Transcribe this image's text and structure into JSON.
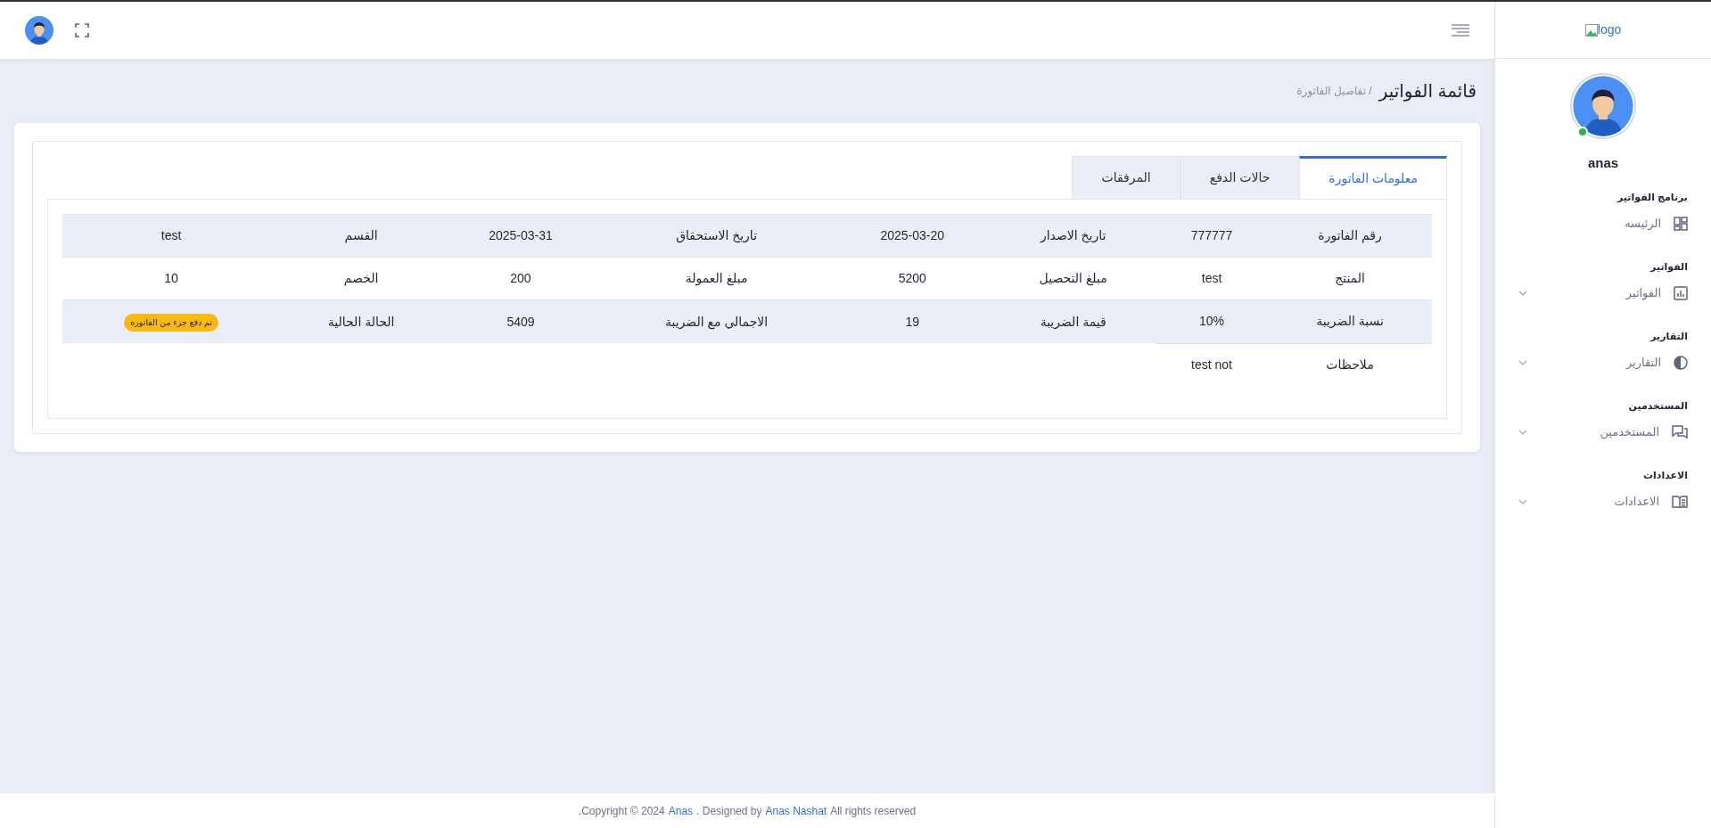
{
  "sidebar": {
    "logo": "logo",
    "user": "anas",
    "sections": [
      {
        "heading": "برنامج الفواتير",
        "item": {
          "label": "الرئيسه",
          "submenu": false
        }
      },
      {
        "heading": "الفواتير",
        "item": {
          "label": "الفواتير",
          "submenu": true
        }
      },
      {
        "heading": "التقارير",
        "item": {
          "label": "التقارير",
          "submenu": true
        }
      },
      {
        "heading": "المستخدمين",
        "item": {
          "label": "المستخدمين",
          "submenu": true
        }
      },
      {
        "heading": "الاعدادات",
        "item": {
          "label": "الاعدادات",
          "submenu": true
        }
      }
    ]
  },
  "page": {
    "title": "قائمة الفواتير",
    "breadcrumb": "/ تفاصيل الفاتورة"
  },
  "tabs": [
    {
      "label": "معلومات الفاتورة",
      "selected": true
    },
    {
      "label": "حالات الدفع",
      "selected": false
    },
    {
      "label": "المرفقات",
      "selected": false
    }
  ],
  "table": {
    "rows": [
      {
        "pairs": [
          {
            "label": "رقم الفاتورة",
            "value": "777777",
            "kind": "text"
          },
          {
            "label": "تاريخ الاصدار",
            "value": "2025-03-20",
            "kind": "text"
          },
          {
            "label": "تاريخ الاستحقاق",
            "value": "2025-03-31",
            "kind": "text"
          },
          {
            "label": "القسم",
            "value": "test",
            "kind": "text"
          }
        ]
      },
      {
        "pairs": [
          {
            "label": "المنتج",
            "value": "test",
            "kind": "text"
          },
          {
            "label": "مبلغ التحصيل",
            "value": "5200",
            "kind": "text"
          },
          {
            "label": "مبلغ العمولة",
            "value": "200",
            "kind": "text"
          },
          {
            "label": "الخصم",
            "value": "10",
            "kind": "text"
          }
        ]
      },
      {
        "pairs": [
          {
            "label": "نسبة الضريبة",
            "value": "10%",
            "kind": "text"
          },
          {
            "label": "قيمة الضريبة",
            "value": "19",
            "kind": "text"
          },
          {
            "label": "الاجمالي مع الضريبة",
            "value": "5409",
            "kind": "text"
          },
          {
            "label": "الحالة الحالية",
            "value": "تم دفع جزء من الفاتوره",
            "kind": "badge"
          }
        ]
      },
      {
        "pairs": [
          {
            "label": "ملاحظات",
            "value": "test not",
            "kind": "text"
          }
        ]
      }
    ]
  },
  "footer": {
    "parts": [
      {
        "kind": "text",
        "text": "All rights reserved"
      },
      {
        "kind": "link",
        "text": "Anas Nashat"
      },
      {
        "kind": "text",
        "text": ". Designed by"
      },
      {
        "kind": "link",
        "text": "Anas"
      },
      {
        "kind": "text",
        "text": ".Copyright © 2024"
      }
    ]
  }
}
